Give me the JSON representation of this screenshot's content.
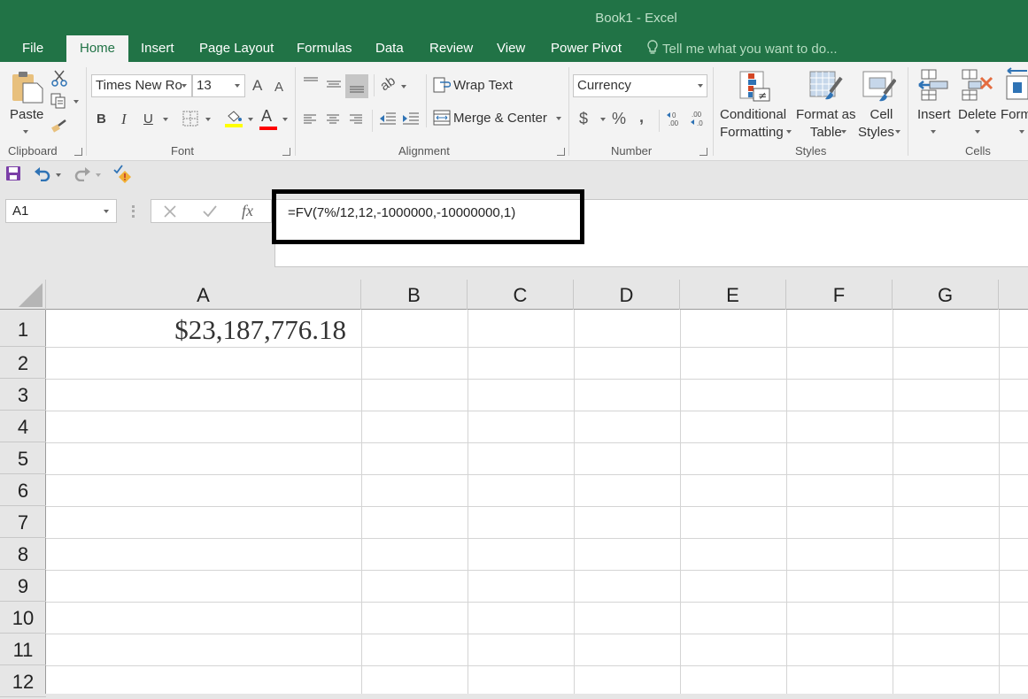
{
  "window": {
    "title": "Book1 - Excel"
  },
  "ribbon_tabs": [
    {
      "label": "File",
      "active": false
    },
    {
      "label": "Home",
      "active": true
    },
    {
      "label": "Insert",
      "active": false
    },
    {
      "label": "Page Layout",
      "active": false
    },
    {
      "label": "Formulas",
      "active": false
    },
    {
      "label": "Data",
      "active": false
    },
    {
      "label": "Review",
      "active": false
    },
    {
      "label": "View",
      "active": false
    },
    {
      "label": "Power Pivot",
      "active": false
    }
  ],
  "tell_me": {
    "placeholder": "Tell me what you want to do...",
    "icon": "lightbulb-icon"
  },
  "clipboard": {
    "label": "Clipboard",
    "paste_label": "Paste"
  },
  "font": {
    "label": "Font",
    "font_name": "Times New Ro",
    "font_size": "13",
    "bold": "B",
    "italic": "I",
    "underline": "U",
    "grow_label": "A",
    "shrink_label": "A",
    "font_color_label": "A",
    "fill_color": "#ffff00",
    "font_color": "#ff0000"
  },
  "alignment": {
    "label": "Alignment",
    "wrap_text": "Wrap Text",
    "merge_center": "Merge & Center"
  },
  "number": {
    "label": "Number",
    "format": "Currency",
    "currency_symbol": "$",
    "percent_symbol": "%",
    "comma_symbol": ",",
    "increase_decimal": "←0\n.00",
    "decrease_decimal": ".00\n→.0"
  },
  "styles": {
    "label": "Styles",
    "conditional_formatting": [
      "Conditional",
      "Formatting"
    ],
    "format_as_table": [
      "Format as",
      "Table"
    ],
    "cell_styles": [
      "Cell",
      "Styles"
    ]
  },
  "cells": {
    "label": "Cells",
    "insert": "Insert",
    "delete": "Delete",
    "format": "Form"
  },
  "formula_bar": {
    "name_box": "A1",
    "fx_label": "fx",
    "formula": "=FV(7%/12,12,-1000000,-10000000,1)"
  },
  "sheet": {
    "columns": [
      "A",
      "B",
      "C",
      "D",
      "E",
      "F",
      "G"
    ],
    "rows": [
      "1",
      "2",
      "3",
      "4",
      "5",
      "6",
      "7",
      "8",
      "9",
      "10",
      "11",
      "12"
    ],
    "cells": {
      "A1": "$23,187,776.18"
    }
  },
  "colors": {
    "brand": "#217346",
    "ribbon_bg": "#f3f3f3"
  }
}
